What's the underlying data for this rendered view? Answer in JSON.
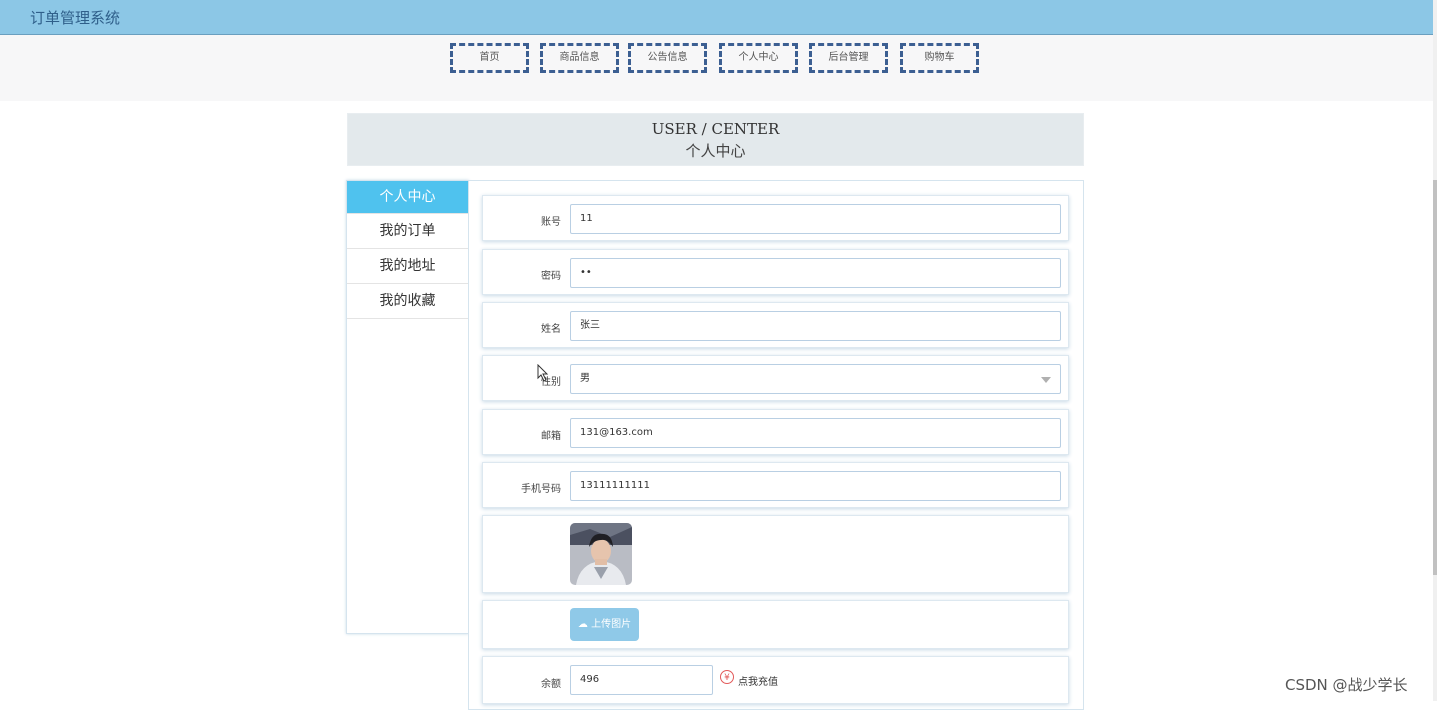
{
  "app": {
    "title": "订单管理系统"
  },
  "nav": [
    {
      "label": "首页"
    },
    {
      "label": "商品信息"
    },
    {
      "label": "公告信息"
    },
    {
      "label": "个人中心"
    },
    {
      "label": "后台管理"
    },
    {
      "label": "购物车"
    }
  ],
  "banner": {
    "en": "USER / CENTER",
    "cn": "个人中心"
  },
  "sidebar": {
    "items": [
      {
        "label": "个人中心",
        "active": true
      },
      {
        "label": "我的订单"
      },
      {
        "label": "我的地址"
      },
      {
        "label": "我的收藏"
      }
    ]
  },
  "form": {
    "account": {
      "label": "账号",
      "value": "11"
    },
    "password": {
      "label": "密码",
      "value": "••"
    },
    "name": {
      "label": "姓名",
      "value": "张三"
    },
    "gender": {
      "label": "性别",
      "value": "男"
    },
    "email": {
      "label": "邮箱",
      "value": "131@163.com"
    },
    "phone": {
      "label": "手机号码",
      "value": "13111111111"
    },
    "upload_label": "上传图片",
    "balance": {
      "label": "余额",
      "value": "496"
    },
    "recharge_label": "点我充值"
  },
  "watermark": "CSDN @战少学长",
  "colors": {
    "topbar": "#8cc7e6",
    "active": "#4fc2ee",
    "nav_border": "#3c5f92"
  }
}
